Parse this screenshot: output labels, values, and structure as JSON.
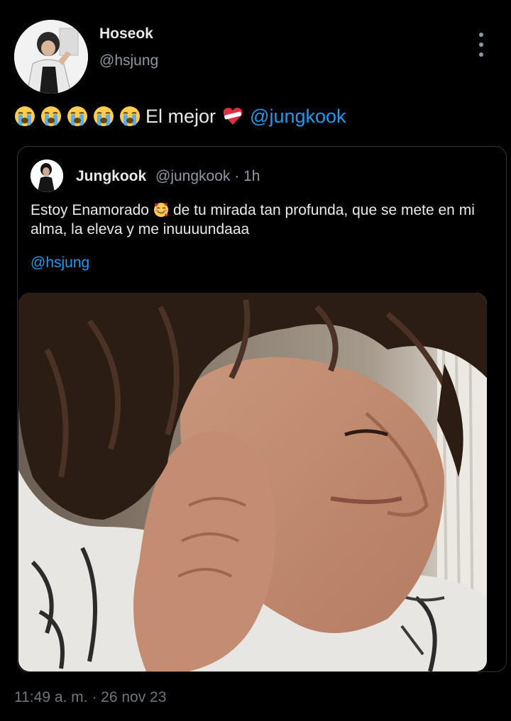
{
  "author": {
    "name": "Hoseok",
    "handle": "@hsjung",
    "avatar_icon": "profile-photo"
  },
  "tweet": {
    "emojis": [
      "loudly-crying-face",
      "loudly-crying-face",
      "loudly-crying-face",
      "loudly-crying-face",
      "loudly-crying-face"
    ],
    "text": "El mejor",
    "heart_emoji": "mending-heart",
    "mention": "@jungkook"
  },
  "quote": {
    "name": "Jungkook",
    "handle_time": "@jungkook · 1h",
    "text_before_emoji": "Estoy Enamorado",
    "emoji": "smiling-face-with-hearts",
    "text_after_emoji": "de tu mirada tan profunda, que se mete en mi alma, la eleva y me inuuuundaaa",
    "mention": "@hsjung",
    "media": "selfie-photo"
  },
  "footer": {
    "timestamp": "11:49 a. m. · 26 nov 23"
  },
  "colors": {
    "background": "#000000",
    "text_primary": "#e7e9ea",
    "text_secondary": "#8b98a5",
    "link": "#1d9bf0",
    "border": "#2f3336"
  }
}
